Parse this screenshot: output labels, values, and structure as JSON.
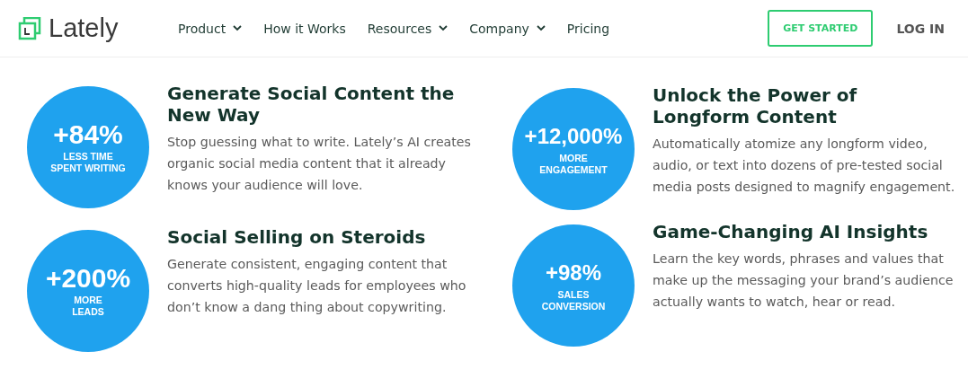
{
  "header": {
    "logo": "Lately",
    "nav": [
      {
        "label": "Product",
        "has_menu": true
      },
      {
        "label": "How it Works",
        "has_menu": false
      },
      {
        "label": "Resources",
        "has_menu": true
      },
      {
        "label": "Company",
        "has_menu": true
      },
      {
        "label": "Pricing",
        "has_menu": false
      }
    ],
    "cta": "GET STARTED",
    "login": "LOG IN"
  },
  "columns": [
    [
      {
        "stat": "+84%",
        "stat_lines": [
          "LESS TIME",
          "SPENT WRITING"
        ],
        "title": "Generate Social Content the New Way",
        "text": "Stop guessing what to write. Lately’s AI creates organic social media content that it already knows your audience will love."
      },
      {
        "stat": "+200%",
        "stat_lines": [
          "MORE",
          "LEADS"
        ],
        "title": "Social Selling on Steroids",
        "text": "Generate consistent, engaging content that converts high-quality leads for employees who don’t know a dang thing about copywriting."
      }
    ],
    [
      {
        "stat": "+12,000%",
        "stat_lines": [
          "MORE",
          "ENGAGEMENT"
        ],
        "title": "Unlock the Power of Longform Content",
        "text": "Automatically atomize any longform video, audio, or text into dozens of pre-tested social media posts designed to magnify engagement."
      },
      {
        "stat": "+98%",
        "stat_lines": [
          "SALES",
          "CONVERSION"
        ],
        "title": "Game-Changing AI Insights",
        "text": "Learn the key words, phrases and values that make up the messaging your brand’s audience actually wants to watch, hear or read."
      }
    ]
  ]
}
